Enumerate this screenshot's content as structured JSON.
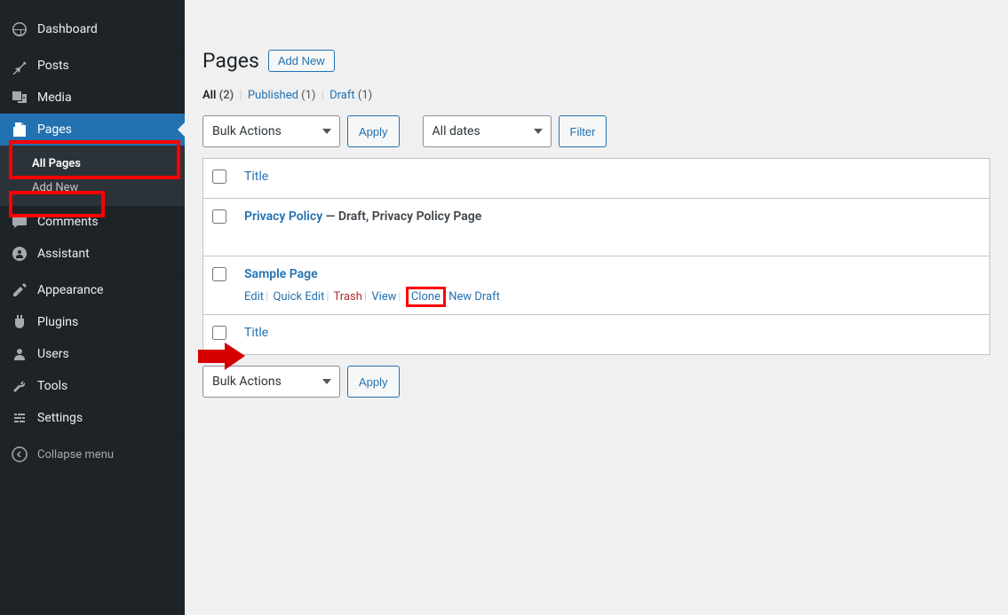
{
  "sidebar": {
    "items": [
      {
        "label": "Dashboard"
      },
      {
        "label": "Posts"
      },
      {
        "label": "Media"
      },
      {
        "label": "Pages"
      },
      {
        "label": "Comments"
      },
      {
        "label": "Assistant"
      },
      {
        "label": "Appearance"
      },
      {
        "label": "Plugins"
      },
      {
        "label": "Users"
      },
      {
        "label": "Tools"
      },
      {
        "label": "Settings"
      }
    ],
    "submenu": {
      "all_pages": "All Pages",
      "add_new": "Add New"
    },
    "collapse": "Collapse menu"
  },
  "heading": {
    "title": "Pages",
    "add_new": "Add New"
  },
  "filters": {
    "all_label": "All",
    "all_count": "(2)",
    "published_label": "Published",
    "published_count": "(1)",
    "draft_label": "Draft",
    "draft_count": "(1)"
  },
  "tablenav": {
    "bulk_actions": "Bulk Actions",
    "apply": "Apply",
    "all_dates": "All dates",
    "filter": "Filter"
  },
  "table": {
    "title_header": "Title",
    "rows": [
      {
        "title": "Privacy Policy",
        "state": " — Draft, Privacy Policy Page"
      },
      {
        "title": "Sample Page"
      }
    ],
    "actions": {
      "edit": "Edit",
      "quick_edit": "Quick Edit",
      "trash": "Trash",
      "view": "View",
      "clone": "Clone",
      "new_draft": "New Draft"
    }
  }
}
